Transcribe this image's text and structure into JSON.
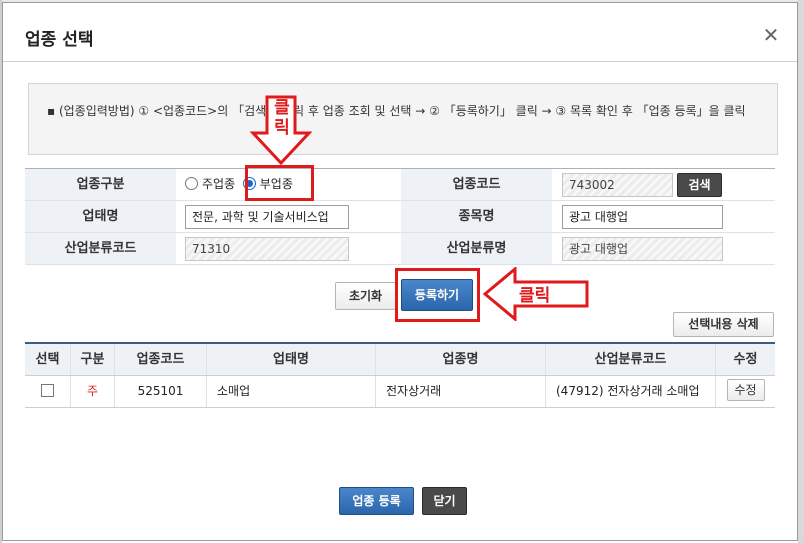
{
  "modal": {
    "title": "업종 선택",
    "guide": "(업종입력방법) ① <업종코드>의 「검색」 클릭 후 업종 조회 및 선택 → ② 「등록하기」 클릭 → ③ 목록 확인 후 「업종 등록」을 클릭"
  },
  "form": {
    "type_label": "업종구분",
    "radio_main": "주업종",
    "radio_sub": "부업종",
    "code_label": "업종코드",
    "code_value": "743002",
    "search_button": "검색",
    "business_label": "업태명",
    "business_value": "전문, 과학 및 기술서비스업",
    "item_label": "종목명",
    "item_value": "광고 대행업",
    "industry_code_label": "산업분류코드",
    "industry_code_value": "71310",
    "industry_name_label": "산업분류명",
    "industry_name_value": "광고 대행업"
  },
  "buttons": {
    "reset": "초기화",
    "register": "등록하기",
    "delete_selected": "선택내용 삭제",
    "submit": "업종 등록",
    "close": "닫기"
  },
  "annotations": {
    "click_top": "클릭",
    "click_right": "클릭",
    "color": "#e0191b"
  },
  "list": {
    "headers": [
      "선택",
      "구분",
      "업종코드",
      "업태명",
      "업종명",
      "산업분류코드",
      "수정"
    ],
    "rows": [
      {
        "type": "주",
        "code": "525101",
        "business": "소매업",
        "item": "전자상거래",
        "industry": "(47912) 전자상거래 소매업",
        "edit": "수정"
      }
    ]
  }
}
